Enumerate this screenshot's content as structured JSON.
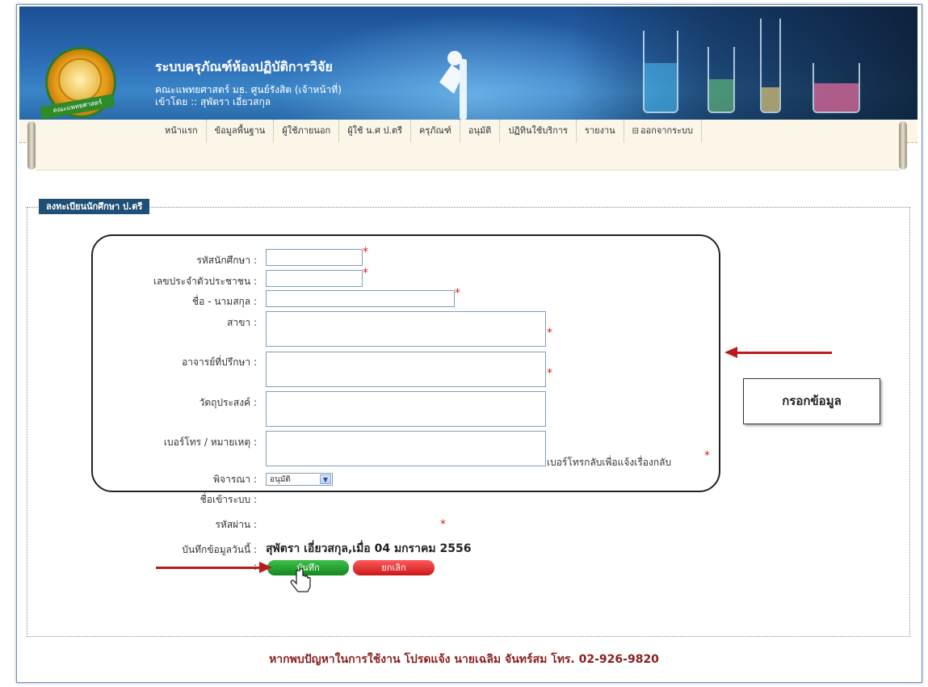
{
  "header": {
    "title": "ระบบครุภัณฑ์ห้องปฏิบัติการวิจัย",
    "subtitle": "คณะแพทยศาสตร์ มธ. ศูนย์รังสิต (เจ้าหน้าที่)",
    "logged_in": "เข้าโดย :: สุพัตรา เอี่ยวสกุล",
    "logo_text": "คณะแพทยศาสตร์"
  },
  "menu": [
    {
      "label": "หน้าแรก"
    },
    {
      "label": "ข้อมูลพื้นฐาน"
    },
    {
      "label": "ผู้ใช้ภายนอก"
    },
    {
      "label": "ผู้ใช้ น.ศ ป.ตรี"
    },
    {
      "label": "ครุภัณฑ์"
    },
    {
      "label": "อนุมัติ"
    },
    {
      "label": "ปฏิทินใช้บริการ"
    },
    {
      "label": "รายงาน"
    },
    {
      "label": "ออกจากระบบ"
    }
  ],
  "form": {
    "legend": "ลงทะเบียนนักศึกษา ป.ตรี",
    "student_id_label": "รหัสนักศึกษา :",
    "national_id_label": "เลขประจำตัวประชาชน :",
    "name_label": "ชื่อ - นามสกุล :",
    "branch_label": "สาขา :",
    "advisor_label": "อาจารย์ที่ปรึกษา :",
    "objective_label": "วัตถุประสงค์ :",
    "phone_label": "เบอร์โทร / หมายเหตุ  :",
    "phone_hint": "เบอร์โทรกลับเพื่อแจ้งเรื่องกลับ",
    "consider_label": "พิจารณา :",
    "consider_value": "อนุมัติ",
    "username_label": "ชื่อเข้าระบบ :",
    "password_label": "รหัสผ่าน :",
    "saved_label": "บันทึกข้อมูลวันนี้  :",
    "saved_value": "สุพัตรา เอี่ยวสกุล,เมื่อ 04 มกราคม 2556",
    "required_mark": "*",
    "colon": ":",
    "save_button": "บันทึก",
    "cancel_button": "ยกเลิก"
  },
  "callout": "กรอกข้อมูล",
  "footer": "หากพบปัญหาในการใช้งาน โปรดแจ้ง นายเฉลิม จันทร์สม โทร. 02-926-9820",
  "colors": {
    "legend_bg": "#1f4f74",
    "save_green": "#14871f",
    "cancel_red": "#c81818",
    "required_red": "#e01b1b",
    "arrow_red": "#b81c1c",
    "footer_text": "#8a1e1e"
  }
}
